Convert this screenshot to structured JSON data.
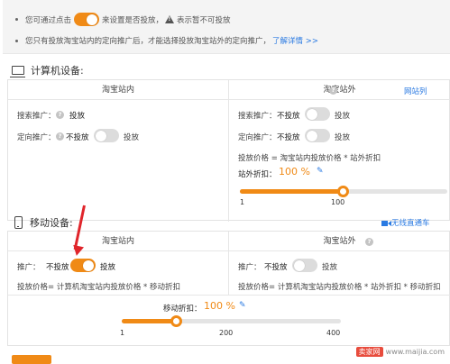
{
  "notice": {
    "line1_before": "您可通过点击",
    "line1_after": "来设置是否投放，",
    "line1_warn": "表示暂不可投放",
    "line2_text": "您只有投放淘宝站内的定向推广后，才能选择投放淘宝站外的定向推广，",
    "line2_link": "了解详情 >>"
  },
  "pc": {
    "section_title": "计算机设备:",
    "col_inside": "淘宝站内",
    "col_outside": "淘宝站外",
    "site_list_link": "网站列",
    "inside": {
      "search_label": "搜索推广：",
      "search_value": "投放",
      "target_label": "定向推广：",
      "target_state": "不投放",
      "target_action": "投放",
      "target_on": false
    },
    "outside": {
      "search_label": "搜索推广：",
      "search_state": "不投放",
      "search_action": "投放",
      "search_on": false,
      "target_label": "定向推广：",
      "target_state": "不投放",
      "target_action": "投放",
      "target_on": false,
      "price_formula": "投放价格 = 淘宝站内投放价格 * 站外折扣",
      "discount_label": "站外折扣：",
      "discount_value": "100 %",
      "slider_min": "1",
      "slider_mid": "100",
      "slider_min_value": 1,
      "slider_max_value": 200,
      "slider_value": 100
    }
  },
  "mobile": {
    "section_title": "移动设备:",
    "live_link": "无线直通车",
    "col_inside": "淘宝站内",
    "col_outside": "淘宝站外",
    "inside": {
      "promo_label": "推广：",
      "promo_state": "不投放",
      "promo_action": "投放",
      "promo_on": true,
      "price_formula": "投放价格= 计算机淘宝站内投放价格 * 移动折扣"
    },
    "outside": {
      "promo_label": "推广：",
      "promo_state": "不投放",
      "promo_action": "投放",
      "promo_on": false,
      "price_formula": "投放价格= 计算机淘宝站内投放价格 * 站外折扣 * 移动折扣"
    },
    "discount_label": "移动折扣：",
    "discount_value": "100 %",
    "slider_min": "1",
    "slider_mid": "200",
    "slider_max": "400",
    "slider_min_value": 1,
    "slider_max_value": 400,
    "slider_value": 100
  },
  "watermark": {
    "badge": "卖家网",
    "url": "www.maijia.com"
  },
  "colors": {
    "accent": "#f08a16",
    "link": "#2a7ae2",
    "arrow": "#e0252b"
  }
}
